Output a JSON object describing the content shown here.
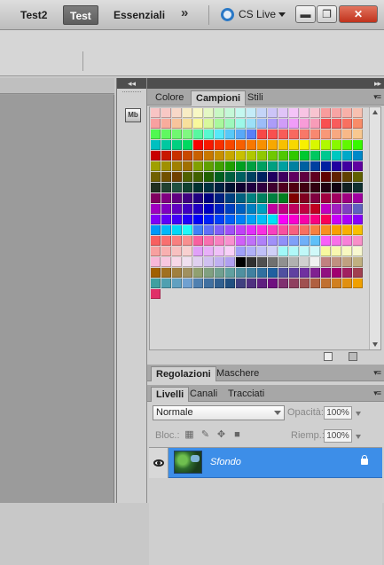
{
  "menubar": {
    "workspaces": [
      "Test2",
      "Test",
      "Essenziali"
    ],
    "active_workspace": "Test",
    "overflow_icon": "double-chevron-right-icon",
    "cs_live_label": "CS Live",
    "window_buttons": [
      "minimize",
      "restore",
      "close"
    ]
  },
  "icon_strip": {
    "collapse_label": "◂◂",
    "mb_label": "Mb"
  },
  "swatch_panel": {
    "collapse_label": "▸▸",
    "tabs": [
      "Colore",
      "Campioni",
      "Stili"
    ],
    "active_tab": "Campioni",
    "menu_icon": "panel-menu-icon",
    "swatch_rows": [
      [
        "#f8c4c4",
        "#f8c8c4",
        "#f8d8c8",
        "#f8ecc4",
        "#f8f8c4",
        "#e4f8c4",
        "#c8f8c4",
        "#c4f8d8",
        "#c4f8f0",
        "#c4ecf8",
        "#c4d4f8",
        "#ccc4f8",
        "#e0c4f8",
        "#f4c4f8",
        "#f8c4e4",
        "#f8c4d0",
        "#f89c9c",
        "#f8a4a4",
        "#f8b0a8",
        "#f8c0b0"
      ],
      [
        "#f8a0a0",
        "#f8ac9c",
        "#f8c49c",
        "#f8e09c",
        "#f8f89c",
        "#d8f89c",
        "#a8f89c",
        "#9cf8bc",
        "#9cf8e8",
        "#9ce0f8",
        "#9cbcf8",
        "#ac9cf8",
        "#d09cf8",
        "#f09cf8",
        "#f89cd8",
        "#f89cb8",
        "#f85050",
        "#f85c5c",
        "#f87060",
        "#f88c68"
      ],
      [
        "#50f850",
        "#60f860",
        "#70f870",
        "#80f880",
        "#58f8a0",
        "#58f8d0",
        "#58e8f8",
        "#58c8f8",
        "#58a8f8",
        "#5880f8",
        "#f84848",
        "#f85050",
        "#f85c58",
        "#f86860",
        "#f87868",
        "#f88870",
        "#f89878",
        "#f8a880",
        "#f8b888",
        "#f8c890"
      ],
      [
        "#00c0c0",
        "#00c8a0",
        "#00d080",
        "#00d860",
        "#f80000",
        "#f81800",
        "#f83000",
        "#f84800",
        "#f86000",
        "#f87800",
        "#f89000",
        "#f8a800",
        "#f8c000",
        "#f8d800",
        "#f8f000",
        "#d8f800",
        "#b0f800",
        "#88f800",
        "#60f800",
        "#38f800"
      ],
      [
        "#c80000",
        "#c81800",
        "#c83000",
        "#c84800",
        "#c86000",
        "#c87800",
        "#c89000",
        "#c8a800",
        "#c8c000",
        "#b0c800",
        "#90c800",
        "#70c800",
        "#50c800",
        "#30c800",
        "#00c830",
        "#00c860",
        "#00c890",
        "#00c8c0",
        "#00a8c8",
        "#0088c8"
      ],
      [
        "#a0a000",
        "#a09000",
        "#a08000",
        "#a07000",
        "#80a000",
        "#60a000",
        "#40a000",
        "#20a000",
        "#00a020",
        "#00a040",
        "#00a060",
        "#00a080",
        "#00a0a0",
        "#0080a0",
        "#0060a0",
        "#0040a0",
        "#0020a0",
        "#2000a0",
        "#4000a0",
        "#6000a0"
      ],
      [
        "#706000",
        "#705000",
        "#704000",
        "#506000",
        "#406000",
        "#206000",
        "#006020",
        "#006040",
        "#006060",
        "#004060",
        "#002060",
        "#200060",
        "#400060",
        "#600060",
        "#600040",
        "#600020",
        "#600000",
        "#602000",
        "#604000",
        "#606000"
      ],
      [
        "#203020",
        "#204030",
        "#205040",
        "#104030",
        "#003030",
        "#003040",
        "#002040",
        "#001030",
        "#100030",
        "#200040",
        "#300040",
        "#400030",
        "#500020",
        "#500010",
        "#400010",
        "#300010",
        "#200010",
        "#100010",
        "#102020",
        "#103030"
      ],
      [
        "#800060",
        "#800080",
        "#600080",
        "#400080",
        "#200080",
        "#000080",
        "#002080",
        "#004080",
        "#006080",
        "#008080",
        "#008060",
        "#008040",
        "#008020",
        "#800000",
        "#800020",
        "#800040",
        "#a00040",
        "#a00060",
        "#a00080",
        "#a000a0"
      ],
      [
        "#a000c0",
        "#8000c0",
        "#6000c0",
        "#4000c0",
        "#2000c0",
        "#0000c0",
        "#0020c0",
        "#0040c0",
        "#0060c0",
        "#0080c0",
        "#00a0c0",
        "#c000a0",
        "#c00080",
        "#c00060",
        "#c00040",
        "#c00020",
        "#c000c0",
        "#a020c0",
        "#8040c0",
        "#6060c0"
      ],
      [
        "#8000f8",
        "#6000f8",
        "#4000f8",
        "#2000f8",
        "#0000f8",
        "#0020f8",
        "#0040f8",
        "#0060f8",
        "#0080f8",
        "#00a0f8",
        "#00c0f8",
        "#00e0f8",
        "#f800f8",
        "#f800d0",
        "#f800a8",
        "#f80080",
        "#f80058",
        "#c800f8",
        "#a800f8",
        "#8800f8"
      ],
      [
        "#0098f8",
        "#00b8f8",
        "#00d8f8",
        "#20f8f8",
        "#4080f8",
        "#6070f8",
        "#8060f8",
        "#a050f8",
        "#c040f8",
        "#e030f8",
        "#f830e0",
        "#f840c0",
        "#f850a0",
        "#f86080",
        "#f87060",
        "#f88040",
        "#f89020",
        "#f8a000",
        "#f8b000",
        "#f8c000"
      ],
      [
        "#f86060",
        "#f87070",
        "#f88080",
        "#f89090",
        "#f860a0",
        "#f870b0",
        "#f880c0",
        "#f890d0",
        "#d060f8",
        "#c070f8",
        "#b080f8",
        "#a090f8",
        "#9090f8",
        "#80a0f8",
        "#70b0f8",
        "#60c0f8",
        "#f860f8",
        "#f870e8",
        "#f880d8",
        "#f890c8"
      ],
      [
        "#f8a0a0",
        "#f8b0b0",
        "#f8c0c0",
        "#f8d0d0",
        "#e0a0f8",
        "#e8b0f8",
        "#f0c0f8",
        "#f8d0f8",
        "#a0a0f8",
        "#b0b0f8",
        "#c0c0f8",
        "#d0d0f8",
        "#a0f8f8",
        "#b0f8f8",
        "#c0f8f8",
        "#d0f8f8",
        "#f8f8a0",
        "#f8f8b0",
        "#f8f8c0",
        "#f8f8d0"
      ],
      [
        "#f8b8d8",
        "#f8c8e0",
        "#f8d8e8",
        "#f0e0f0",
        "#e0d0f0",
        "#d0c0f0",
        "#c0b0f0",
        "#b0a0f0",
        "#000000",
        "#303030",
        "#505050",
        "#707070",
        "#909090",
        "#b0b0b0",
        "#d0d0d0",
        "#f0f0f0",
        "#c08080",
        "#c09080",
        "#c0a080",
        "#c0b080"
      ],
      [
        "#a06000",
        "#a07020",
        "#a08040",
        "#a09060",
        "#90a070",
        "#80a080",
        "#70a090",
        "#60a0a0",
        "#5090a0",
        "#4080a0",
        "#3070a0",
        "#2060a0",
        "#5050a0",
        "#6040a0",
        "#7030a0",
        "#802090",
        "#901080",
        "#a00070",
        "#a02060",
        "#a04050"
      ],
      [
        "#40a0a0",
        "#50a0b0",
        "#60a0c0",
        "#70a0d0",
        "#5080b0",
        "#4070a0",
        "#306090",
        "#205080",
        "#404080",
        "#503080",
        "#602080",
        "#701080",
        "#803070",
        "#904060",
        "#a05050",
        "#b06040",
        "#c07030",
        "#d08020",
        "#e09010",
        "#f0a000"
      ],
      [
        "#e03068"
      ]
    ]
  },
  "adjust_panel": {
    "tabs": [
      "Regolazioni",
      "Maschere"
    ],
    "active_tab": "Regolazioni"
  },
  "layers_panel": {
    "tabs": [
      "Livelli",
      "Canali",
      "Tracciati"
    ],
    "active_tab": "Livelli",
    "blend_mode": "Normale",
    "opacity_label": "Opacità:",
    "opacity_value": "100%",
    "lock_label": "Bloc.:",
    "fill_label": "Riemp.:",
    "fill_value": "100%",
    "layers": [
      {
        "name": "Sfondo",
        "visible": true,
        "locked": true,
        "selected": true
      }
    ]
  },
  "colors": {
    "selection": "#3d8ee8",
    "active_workspace_bg": "#6b6b6b",
    "close_button": "#c8412a",
    "cs_live_icon": "#2a78c6"
  }
}
